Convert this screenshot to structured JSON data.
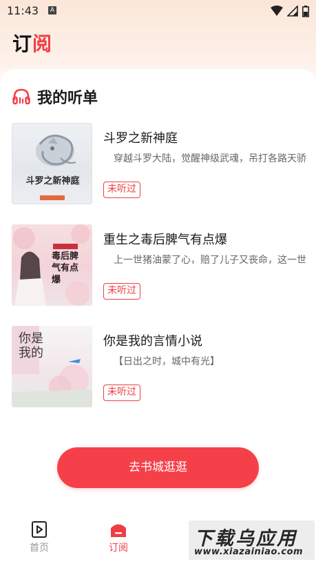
{
  "status_bar": {
    "time": "11:43",
    "notice_glyph": "A"
  },
  "header": {
    "title_part1": "订",
    "title_part2": "阅"
  },
  "section": {
    "title": "我的听单",
    "icon": "headphones-icon"
  },
  "books": [
    {
      "title": "斗罗之新神庭",
      "desc": "穿越斗罗大陆，觉醒神级武魂，吊打各路天骄",
      "status": "未听过",
      "cover_text": "斗罗之新神庭"
    },
    {
      "title": "重生之毒后脾气有点爆",
      "desc": "上一世猪油蒙了心，赔了儿子又丧命，这一世",
      "status": "未听过",
      "cover_text": "毒后脾气有点爆"
    },
    {
      "title": "你是我的言情小说",
      "desc": "【日出之时，城中有光】",
      "status": "未听过",
      "cover_text": "你是我的"
    }
  ],
  "cta": {
    "label": "去书城逛逛"
  },
  "tabbar": {
    "items": [
      {
        "label": "首页",
        "icon": "play-book-icon",
        "active": false
      },
      {
        "label": "订阅",
        "icon": "subscribe-icon",
        "active": true
      }
    ]
  },
  "watermark": {
    "line1": "下载乌应用",
    "line2": "www.xiazainiao.com"
  },
  "colors": {
    "accent": "#f23c44",
    "cta": "#f64049"
  }
}
